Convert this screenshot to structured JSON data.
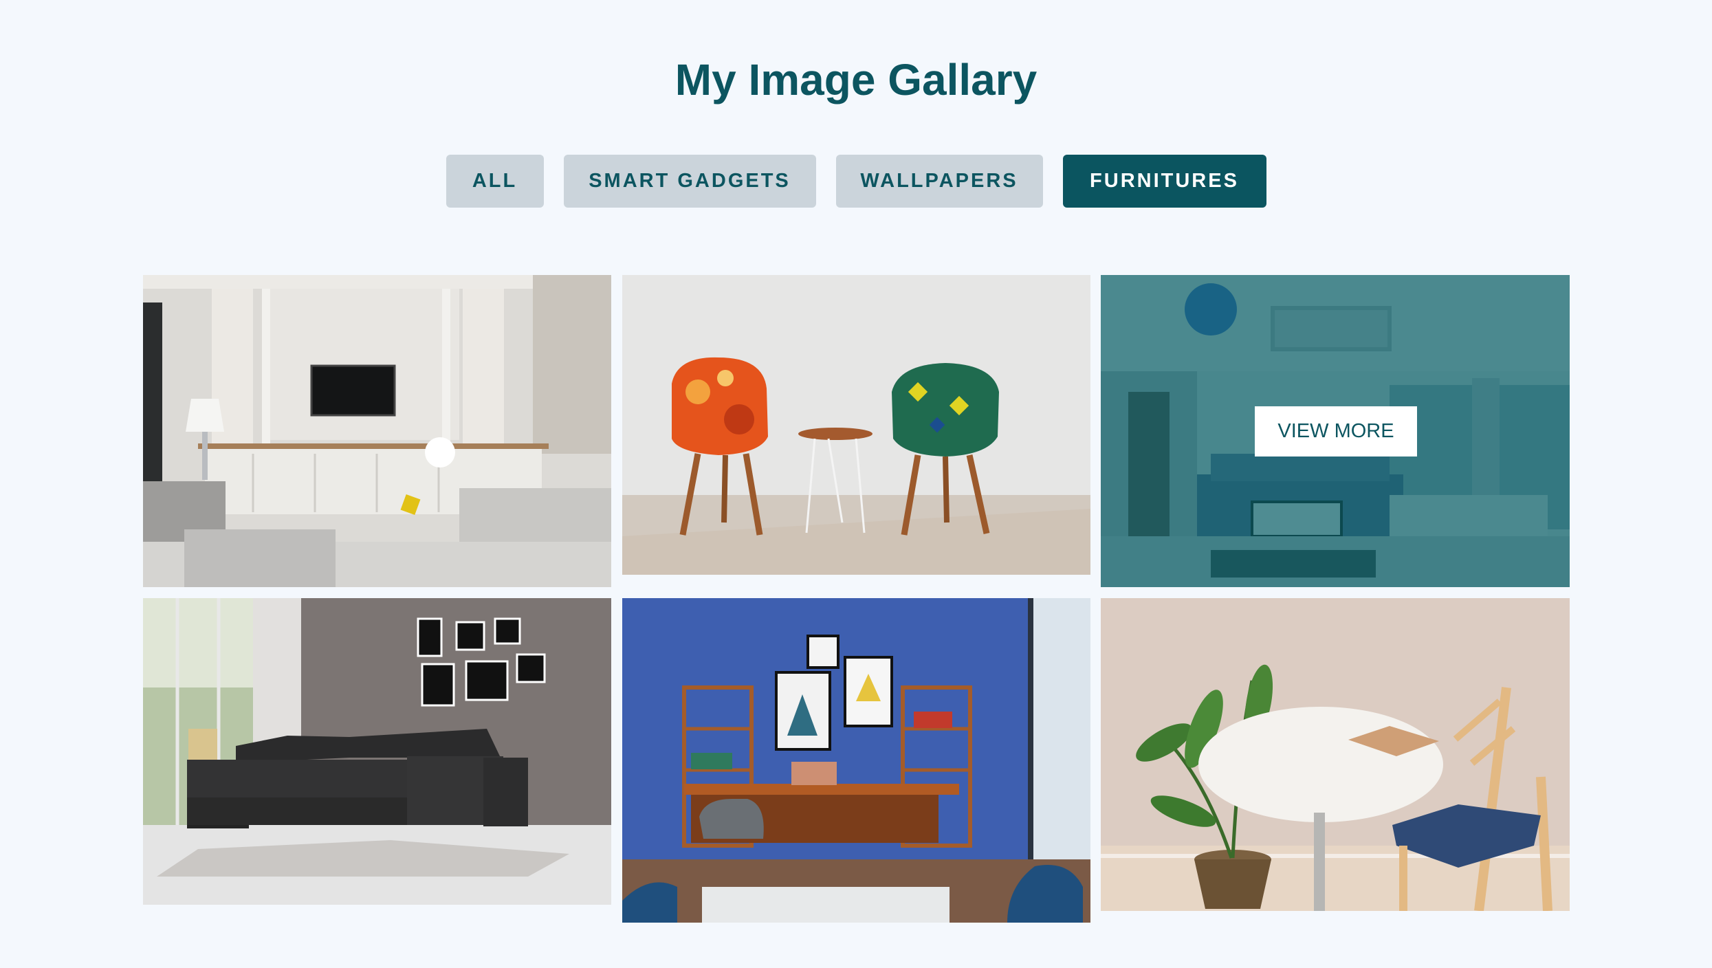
{
  "page": {
    "title": "My Image Gallary"
  },
  "filters": [
    {
      "label": "ALL",
      "active": false
    },
    {
      "label": "SMART GADGETS",
      "active": false
    },
    {
      "label": "WALLPAPERS",
      "active": false
    },
    {
      "label": "FURNITURES",
      "active": true
    }
  ],
  "gallery": {
    "view_more_label": "VIEW MORE",
    "images": [
      {
        "subject": "living-room-tv-unit"
      },
      {
        "subject": "patterned-chairs"
      },
      {
        "subject": "open-plan-living-room"
      },
      {
        "subject": "black-sectional-sofa"
      },
      {
        "subject": "blue-wall-study"
      },
      {
        "subject": "round-table-chair"
      }
    ]
  },
  "colors": {
    "background": "#f4f8fd",
    "primary": "#0b5560",
    "button_inactive": "#cbd4db",
    "overlay": "#0b5f68"
  }
}
